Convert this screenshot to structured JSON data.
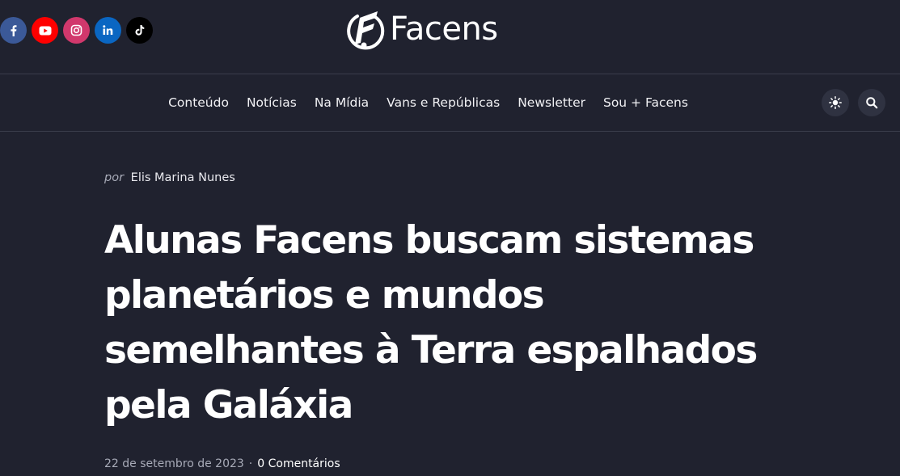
{
  "header": {
    "logo_text": "Facens",
    "social": [
      {
        "icon": "facebook-icon",
        "color": "#3b5998"
      },
      {
        "icon": "youtube-icon",
        "color": "#ff0000"
      },
      {
        "icon": "instagram-icon",
        "color": "#d1386c"
      },
      {
        "icon": "linkedin-icon",
        "color": "#0a66c2"
      },
      {
        "icon": "tiktok-icon",
        "color": "#000000"
      }
    ]
  },
  "nav": {
    "items": [
      "Conteúdo",
      "Notícias",
      "Na Mídia",
      "Vans e Repúblicas",
      "Newsletter",
      "Sou + Facens"
    ],
    "theme_toggle_icon": "sun-icon",
    "search_icon": "search-icon"
  },
  "article": {
    "by_prefix": "por",
    "author": "Elis Marina Nunes",
    "title": "Alunas Facens buscam sistemas planetários e mundos semelhantes à Terra espalhados pela Galáxia",
    "date": "22 de setembro de 2023",
    "separator": "·",
    "comments": "0 Comentários"
  },
  "colors": {
    "background": "#20222f",
    "divider": "#3a3d4b",
    "button_bg": "#2f3241"
  }
}
